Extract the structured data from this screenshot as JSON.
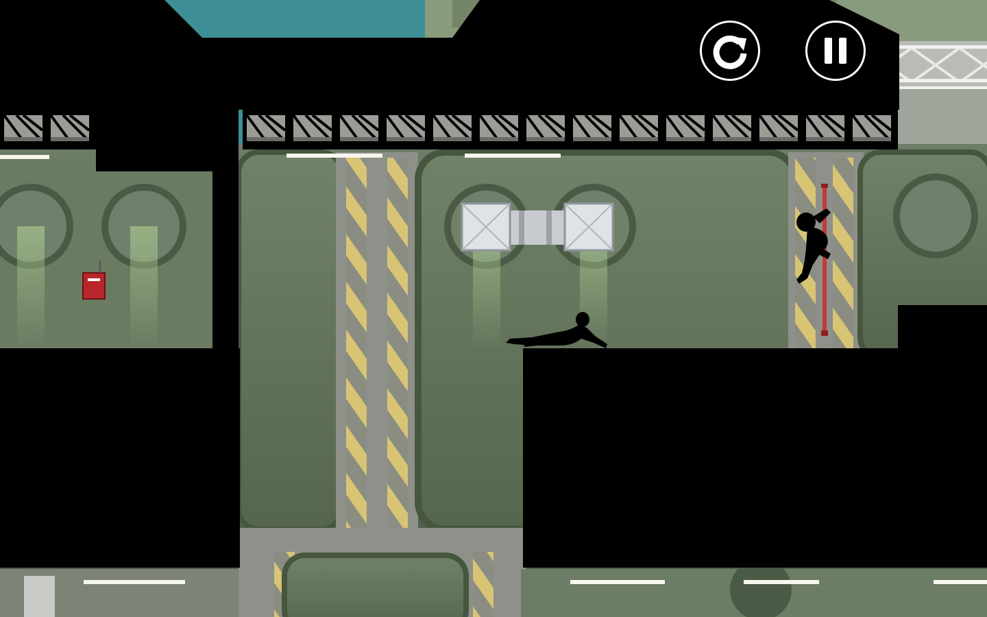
{
  "game": {
    "hud": {
      "restart_icon": "restart-icon",
      "pause_icon": "pause-icon"
    },
    "colors": {
      "sky": "#3f8f96",
      "wall": "#5a6b55",
      "wall_dark": "#46563f",
      "concrete": "#8f9289",
      "hazard_yellow": "#d9c46a",
      "silhouette": "#000000",
      "hud_ring": "#ffffff",
      "alarm_red": "#b8262b",
      "pipe_red": "#c23a3a"
    },
    "characters": [
      {
        "role": "player",
        "pose": "sliding",
        "icon": "runner-silhouette"
      },
      {
        "role": "hunter",
        "pose": "climbing",
        "icon": "hunter-silhouette"
      }
    ],
    "props": [
      "ceiling-truss",
      "ventilation-duct",
      "fire-alarm-box",
      "vertical-red-pipe",
      "porthole-windows",
      "hazard-stripe-pillars",
      "ceiling-lights"
    ]
  }
}
